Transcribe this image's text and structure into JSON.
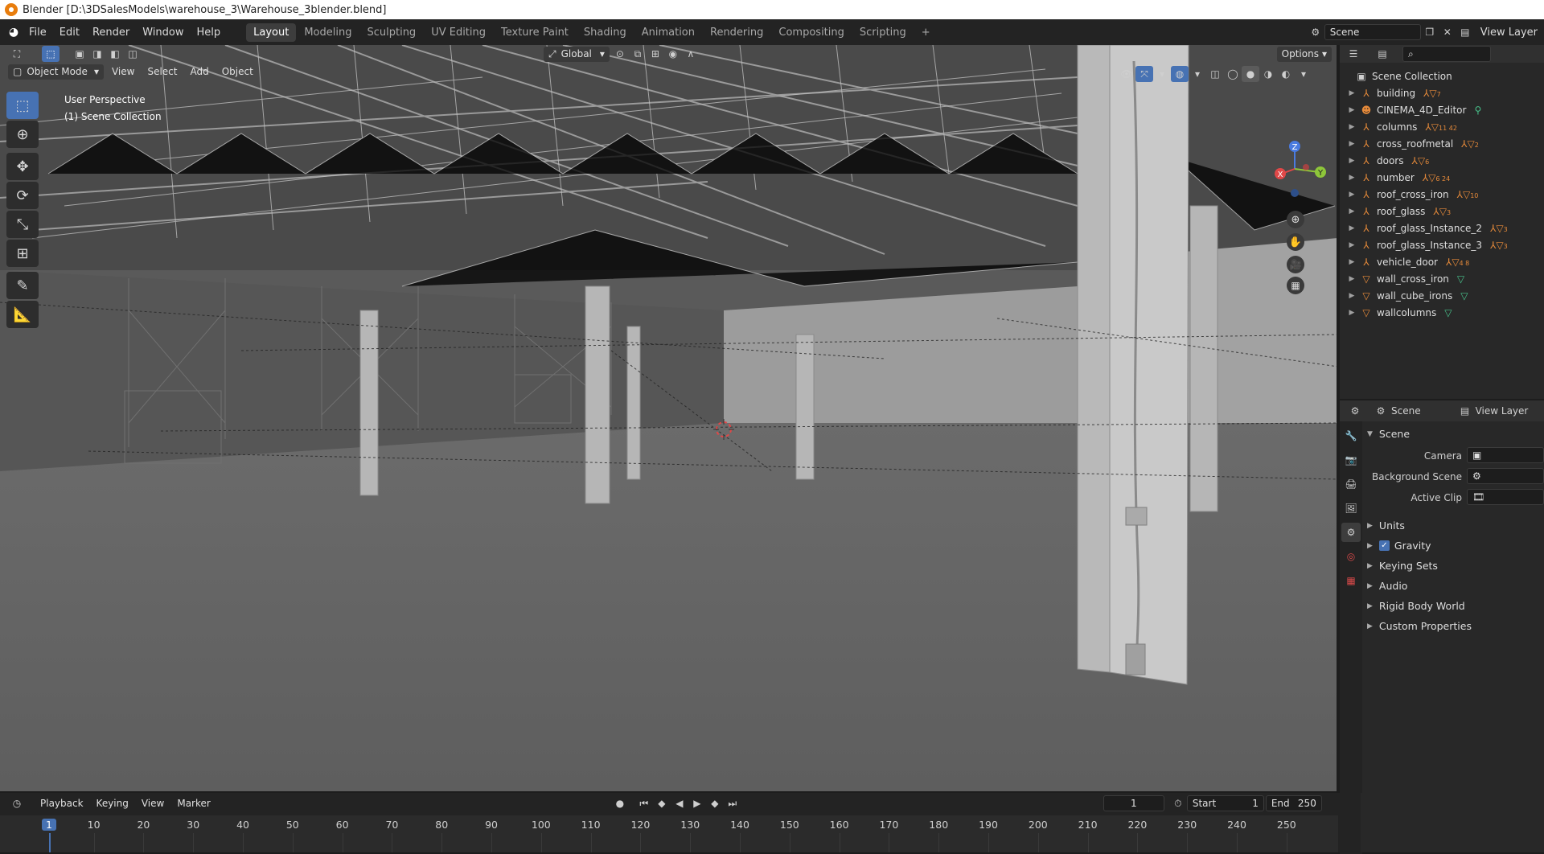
{
  "title_bar": {
    "text": "Blender [D:\\3DSalesModels\\warehouse_3\\Warehouse_3blender.blend]"
  },
  "menu": {
    "items": [
      "File",
      "Edit",
      "Render",
      "Window",
      "Help"
    ],
    "workspaces": [
      "Layout",
      "Modeling",
      "Sculpting",
      "UV Editing",
      "Texture Paint",
      "Shading",
      "Animation",
      "Rendering",
      "Compositing",
      "Scripting"
    ],
    "active_workspace": "Layout",
    "add_tab": "+",
    "scene_name": "Scene",
    "view_layer": "View Layer"
  },
  "viewport": {
    "transform_orientation": "Global",
    "options_label": "Options",
    "mode": "Object Mode",
    "menus": [
      "View",
      "Select",
      "Add",
      "Object"
    ],
    "overlay_line1": "User Perspective",
    "overlay_line2": "(1) Scene Collection",
    "gizmo_axes": {
      "z": "Z",
      "y": "Y",
      "x": "X"
    }
  },
  "outliner": {
    "root": "Scene Collection",
    "items": [
      {
        "name": "building",
        "sub": "7"
      },
      {
        "name": "CINEMA_4D_Editor",
        "sub": ""
      },
      {
        "name": "columns",
        "sub": "11 42"
      },
      {
        "name": "cross_roofmetal",
        "sub": "2"
      },
      {
        "name": "doors",
        "sub": "6"
      },
      {
        "name": "number",
        "sub": "6 24"
      },
      {
        "name": "roof_cross_iron",
        "sub": "10"
      },
      {
        "name": "roof_glass",
        "sub": "3"
      },
      {
        "name": "roof_glass_Instance_2",
        "sub": "3"
      },
      {
        "name": "roof_glass_Instance_3",
        "sub": "3"
      },
      {
        "name": "vehicle_door",
        "sub": "4 8"
      },
      {
        "name": "wall_cross_iron",
        "sub": ""
      },
      {
        "name": "wall_cube_irons",
        "sub": ""
      },
      {
        "name": "wallcolumns",
        "sub": ""
      }
    ]
  },
  "properties": {
    "scene_tab": "Scene",
    "view_layer_tab": "View Layer",
    "panel_title": "Scene",
    "camera_label": "Camera",
    "background_scene_label": "Background Scene",
    "active_clip_label": "Active Clip",
    "sections": [
      "Units",
      "Gravity",
      "Keying Sets",
      "Audio",
      "Rigid Body World",
      "Custom Properties"
    ],
    "gravity_checked": true
  },
  "timeline": {
    "menus": [
      "Playback",
      "Keying",
      "View",
      "Marker"
    ],
    "current_frame": "1",
    "start_label": "Start",
    "start_value": "1",
    "end_label": "End",
    "end_value": "250",
    "ruler_labels": [
      "1",
      "10",
      "20",
      "30",
      "40",
      "50",
      "60",
      "70",
      "80",
      "90",
      "100",
      "110",
      "120",
      "130",
      "140",
      "150",
      "160",
      "170",
      "180",
      "190",
      "200",
      "210",
      "220",
      "230",
      "240",
      "250"
    ]
  }
}
